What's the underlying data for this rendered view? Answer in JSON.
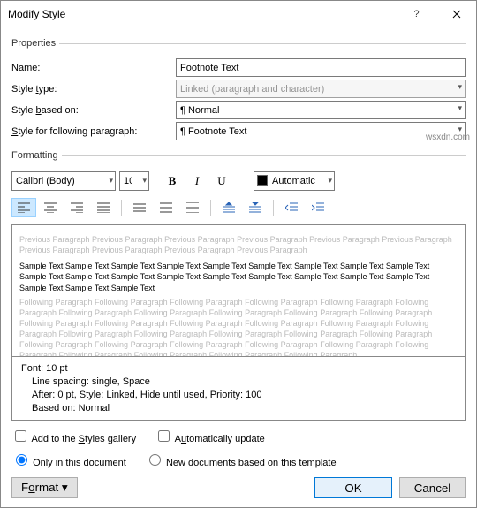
{
  "titlebar": {
    "title": "Modify Style"
  },
  "properties": {
    "legend": "Properties",
    "name_label": "Name:",
    "name_value": "Footnote Text",
    "type_label": "Style type:",
    "type_value": "Linked (paragraph and character)",
    "based_label": "Style based on:",
    "based_value": "¶ Normal",
    "following_label": "Style for following paragraph:",
    "following_value": "¶ Footnote Text"
  },
  "formatting": {
    "legend": "Formatting",
    "font_name": "Calibri (Body)",
    "font_size": "10",
    "bold": "B",
    "italic": "I",
    "underline": "U",
    "color_label": "Automatic"
  },
  "preview": {
    "prev": "Previous Paragraph Previous Paragraph Previous Paragraph Previous Paragraph Previous Paragraph Previous Paragraph Previous Paragraph Previous Paragraph Previous Paragraph Previous Paragraph",
    "sample": "Sample Text Sample Text Sample Text Sample Text Sample Text Sample Text Sample Text Sample Text Sample Text Sample Text Sample Text Sample Text Sample Text Sample Text Sample Text Sample Text Sample Text Sample Text Sample Text Sample Text Sample Text",
    "next": "Following Paragraph Following Paragraph Following Paragraph Following Paragraph Following Paragraph Following Paragraph Following Paragraph Following Paragraph Following Paragraph Following Paragraph Following Paragraph Following Paragraph Following Paragraph Following Paragraph Following Paragraph Following Paragraph Following Paragraph Following Paragraph Following Paragraph Following Paragraph Following Paragraph Following Paragraph Following Paragraph Following Paragraph Following Paragraph Following Paragraph Following Paragraph Following Paragraph Following Paragraph Following Paragraph Following Paragraph Following Paragraph"
  },
  "description": {
    "line1": "Font: 10 pt",
    "line2": "Line spacing:  single, Space",
    "line3": "After:  0 pt, Style: Linked, Hide until used, Priority: 100",
    "line4": "Based on: Normal"
  },
  "options": {
    "add_gallery": "Add to the Styles gallery",
    "auto_update": "Automatically update",
    "only_doc": "Only in this document",
    "new_tmpl": "New documents based on this template"
  },
  "footer": {
    "format": "Format ▾",
    "ok": "OK",
    "cancel": "Cancel"
  },
  "watermark": "wsxdn.com"
}
